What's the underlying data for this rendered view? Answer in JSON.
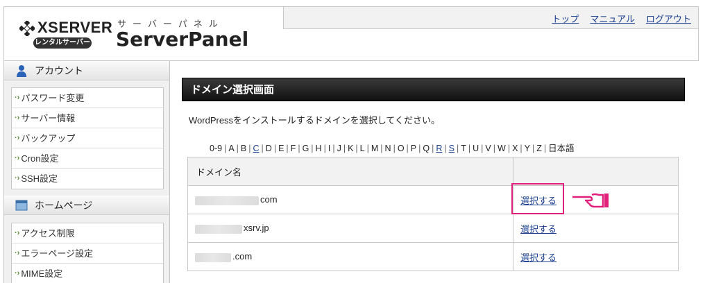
{
  "header": {
    "brand_word": "XSERVER",
    "brand_badge": "レンタルサーバー",
    "panel_kana": "サーバーパネル",
    "panel_title": "ServerPanel",
    "nav": [
      "トップ",
      "マニュアル",
      "ログアウト"
    ]
  },
  "sidebar": {
    "sections": [
      {
        "title": "アカウント",
        "icon": "person-icon",
        "items": [
          "パスワード変更",
          "サーバー情報",
          "バックアップ",
          "Cron設定",
          "SSH設定"
        ]
      },
      {
        "title": "ホームページ",
        "icon": "window-icon",
        "items": [
          "アクセス制限",
          "エラーページ設定",
          "MIME設定"
        ]
      }
    ]
  },
  "main": {
    "title": "ドメイン選択画面",
    "description": "WordPressをインストールするドメインを選択してください。",
    "alpha_index": [
      "0-9",
      "A",
      "B",
      "C",
      "D",
      "E",
      "F",
      "G",
      "H",
      "I",
      "J",
      "K",
      "L",
      "M",
      "N",
      "O",
      "P",
      "Q",
      "R",
      "S",
      "T",
      "U",
      "V",
      "W",
      "X",
      "Y",
      "Z",
      "日本語"
    ],
    "alpha_links": [
      "C",
      "R",
      "S"
    ],
    "table": {
      "header_domain": "ドメイン名",
      "header_action": "",
      "rows": [
        {
          "domain_suffix": "com",
          "action": "選択する"
        },
        {
          "domain_suffix": "xsrv.jp",
          "action": "選択する"
        },
        {
          "domain_suffix": ".com",
          "action": "選択する"
        }
      ]
    }
  },
  "colors": {
    "title_bar": "#1a1a1a",
    "link": "#1a3f8f",
    "highlight": "#e0207a"
  }
}
